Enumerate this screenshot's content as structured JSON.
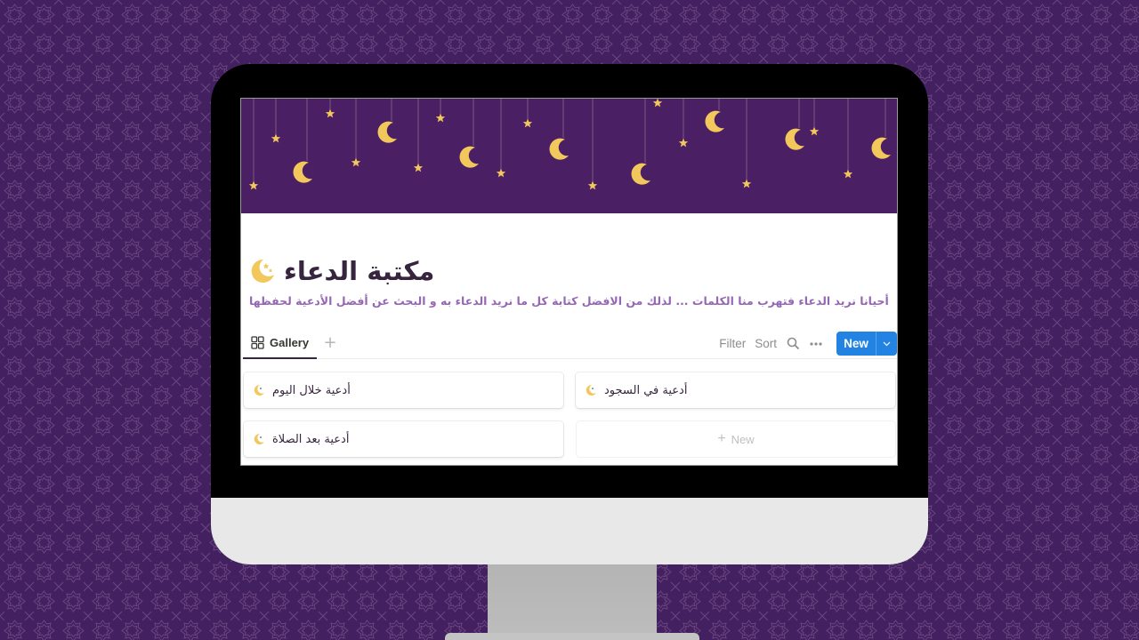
{
  "page": {
    "title": "مكتبة الدعاء",
    "title_icon": "crescent-moon-stars-icon",
    "description": "أحيانا نريد الدعاء فتهرب منا الكلمات ... لذلك من الافضل كتابة كل ما نريد الدعاء به و البحث عن أفضل الأدعية لحفظها"
  },
  "views": {
    "tabs": [
      {
        "label": "Gallery",
        "icon": "gallery-grid-icon",
        "active": true
      }
    ],
    "add_view_label": "+"
  },
  "toolbar": {
    "filter_label": "Filter",
    "sort_label": "Sort",
    "search_icon": "search-icon",
    "more_icon": "more-horizontal-icon",
    "new_label": "New",
    "new_caret_icon": "chevron-down-icon"
  },
  "gallery": {
    "cards": [
      {
        "title": "أدعية خلال اليوم",
        "icon": "crescent-moon-icon"
      },
      {
        "title": "أدعية في السجود",
        "icon": "crescent-moon-icon"
      },
      {
        "title": "أدعية بعد الصلاة",
        "icon": "crescent-moon-icon"
      }
    ],
    "add_new_label": "New"
  },
  "colors": {
    "background": "#43205f",
    "banner": "#4a1f63",
    "gold": "#f2c75c",
    "accent_blue": "#2383e2",
    "description_text": "#9567b5",
    "title_text": "#37253f"
  }
}
